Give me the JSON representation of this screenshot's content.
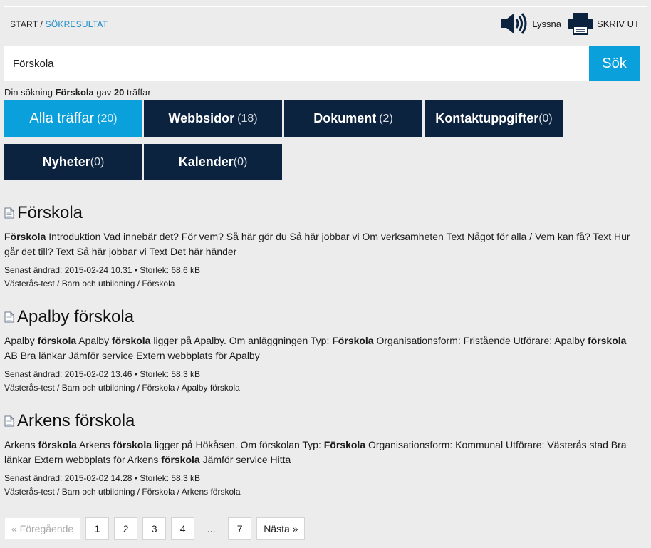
{
  "breadcrumb": {
    "start": "START",
    "separator": " / ",
    "current": "SÖKRESULTAT"
  },
  "tools": {
    "listen": "Lyssna",
    "print": "SKRIV UT"
  },
  "search": {
    "value": "Förskola",
    "button": "Sök"
  },
  "summary": {
    "prefix": "Din sökning ",
    "query": "Förskola",
    "middle": " gav ",
    "count": "20",
    "suffix": " träffar"
  },
  "tabs": [
    {
      "label": "Alla träffar",
      "count": "(20)"
    },
    {
      "label": "Webbsidor",
      "count": "(18)"
    },
    {
      "label": "Dokument",
      "count": "(2)"
    },
    {
      "label": "Kontaktuppgifter",
      "count": "(0)"
    },
    {
      "label": "Nyheter",
      "count": "(0)"
    },
    {
      "label": "Kalender",
      "count": "(0)"
    }
  ],
  "results": [
    {
      "title": "Förskola",
      "snippet": [
        {
          "t": "Förskola",
          "b": true
        },
        {
          "t": " Introduktion Vad innebär det? För vem? Så här gör du Så här jobbar vi Om verksamheten Text Något för alla / Vem kan få? Text Hur går det till? Text Så här jobbar vi Text Det här händer",
          "b": false
        }
      ],
      "modified": "Senast ändrad: 2015-02-24 10.31 • Storlek: 68.6 kB",
      "path": "Västerås-test / Barn och utbildning / Förskola"
    },
    {
      "title": "Apalby förskola",
      "snippet": [
        {
          "t": "Apalby ",
          "b": false
        },
        {
          "t": "förskola",
          "b": true
        },
        {
          "t": " Apalby ",
          "b": false
        },
        {
          "t": "förskola",
          "b": true
        },
        {
          "t": " ligger på Apalby. Om anläggningen Typ: ",
          "b": false
        },
        {
          "t": "Förskola",
          "b": true
        },
        {
          "t": " Organisationsform: Fristående Utförare: Apalby ",
          "b": false
        },
        {
          "t": "förskola",
          "b": true
        },
        {
          "t": " AB Bra länkar Jämför service Extern webbplats för Apalby",
          "b": false
        }
      ],
      "modified": "Senast ändrad: 2015-02-02 13.46 • Storlek: 58.3 kB",
      "path": "Västerås-test / Barn och utbildning / Förskola / Apalby förskola"
    },
    {
      "title": "Arkens förskola",
      "snippet": [
        {
          "t": "Arkens ",
          "b": false
        },
        {
          "t": "förskola",
          "b": true
        },
        {
          "t": " Arkens ",
          "b": false
        },
        {
          "t": "förskola",
          "b": true
        },
        {
          "t": " ligger på Hökåsen. Om förskolan Typ: ",
          "b": false
        },
        {
          "t": "Förskola",
          "b": true
        },
        {
          "t": " Organisationsform: Kommunal Utförare: Västerås stad Bra länkar Extern webbplats för Arkens ",
          "b": false
        },
        {
          "t": "förskola",
          "b": true
        },
        {
          "t": " Jämför service Hitta",
          "b": false
        }
      ],
      "modified": "Senast ändrad: 2015-02-02 14.28 • Storlek: 58.3 kB",
      "path": "Västerås-test / Barn och utbildning / Förskola / Arkens förskola"
    }
  ],
  "pager": {
    "prev": "« Föregående",
    "pages": [
      "1",
      "2",
      "3",
      "4"
    ],
    "ellipsis": "...",
    "last": "7",
    "next": "Nästa »"
  }
}
